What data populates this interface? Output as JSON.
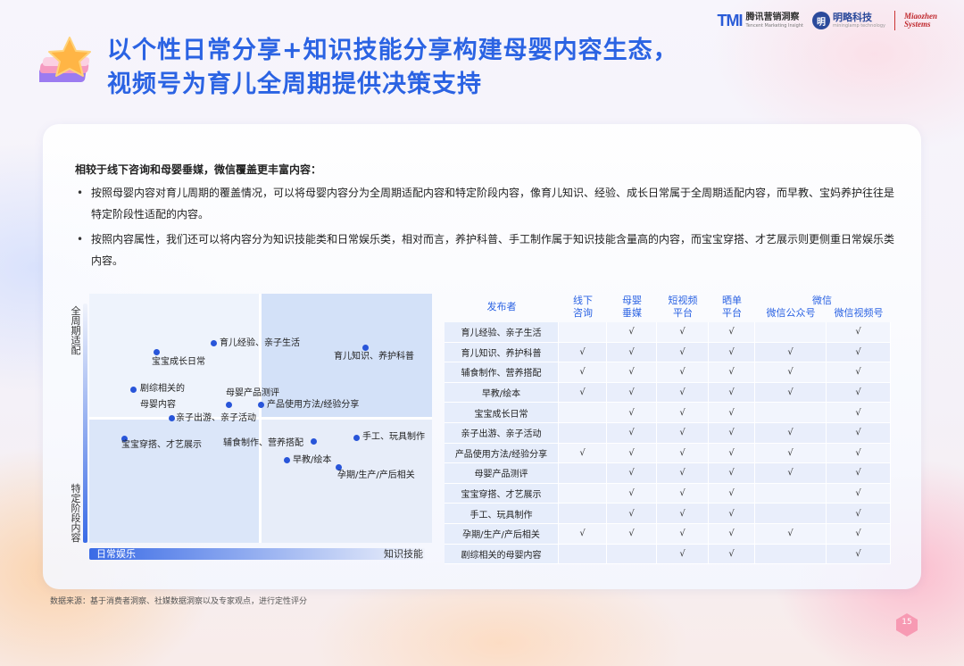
{
  "header": {
    "tmi_mark": "TMI",
    "tmi_cn": "腾讯营销洞察",
    "tmi_en": "Tencent Marketing Insight",
    "mlk_mark": "明",
    "mlk_cn": "明略科技",
    "mlk_en": "mininglamp technology",
    "mz_line1": "Miaozhen",
    "mz_line2": "Systems"
  },
  "title": {
    "line1": "以个性日常分享+知识技能分享构建母婴内容生态，",
    "line2": "视频号为育儿全周期提供决策支持"
  },
  "intro": {
    "heading": "相较于线下咨询和母婴垂媒，微信覆盖更丰富内容：",
    "bullet1": "按照母婴内容对育儿周期的覆盖情况，可以将母婴内容分为全周期适配内容和特定阶段内容，像育儿知识、经验、成长日常属于全周期适配内容，而早教、宝妈养护往往是特定阶段性适配的内容。",
    "bullet2": "按照内容属性，我们还可以将内容分为知识技能类和日常娱乐类，相对而言，养护科普、手工制作属于知识技能含量高的内容，而宝宝穿搭、才艺展示则更侧重日常娱乐类内容。"
  },
  "quadrant": {
    "y_top": "全周期适配",
    "y_bottom": "特定阶段内容",
    "x_left": "日常娱乐",
    "x_right": "知识技能",
    "points": {
      "p1": "育儿经验、亲子生活",
      "p2": "宝宝成长日常",
      "p3": "育儿知识、养护科普",
      "p4a": "剧综相关的",
      "p4b": "母婴内容",
      "p5": "母婴产品测评",
      "p6": "产品使用方法/经验分享",
      "p7": "亲子出游、亲子活动",
      "p8": "宝宝穿搭、才艺展示",
      "p9": "辅食制作、营养搭配",
      "p10": "手工、玩具制作",
      "p11": "早教/绘本",
      "p12": "孕期/生产/产后相关"
    }
  },
  "table": {
    "headers": {
      "publisher": "发布者",
      "offline_1": "线下",
      "offline_2": "咨询",
      "maternal_1": "母婴",
      "maternal_2": "垂媒",
      "short_1": "短视频",
      "short_2": "平台",
      "share_1": "晒单",
      "share_2": "平台",
      "wechat": "微信",
      "wechat_oa": "微信公众号",
      "wechat_ch": "微信视频号"
    },
    "rows": [
      {
        "name": "育儿经验、亲子生活",
        "c": [
          "",
          "√",
          "√",
          "√",
          "",
          "√"
        ]
      },
      {
        "name": "育儿知识、养护科普",
        "c": [
          "√",
          "√",
          "√",
          "√",
          "√",
          "√"
        ]
      },
      {
        "name": "辅食制作、营养搭配",
        "c": [
          "√",
          "√",
          "√",
          "√",
          "√",
          "√"
        ]
      },
      {
        "name": "早教/绘本",
        "c": [
          "√",
          "√",
          "√",
          "√",
          "√",
          "√"
        ]
      },
      {
        "name": "宝宝成长日常",
        "c": [
          "",
          "√",
          "√",
          "√",
          "",
          "√"
        ]
      },
      {
        "name": "亲子出游、亲子活动",
        "c": [
          "",
          "√",
          "√",
          "√",
          "√",
          "√"
        ]
      },
      {
        "name": "产品使用方法/经验分享",
        "c": [
          "√",
          "√",
          "√",
          "√",
          "√",
          "√"
        ]
      },
      {
        "name": "母婴产品测评",
        "c": [
          "",
          "√",
          "√",
          "√",
          "√",
          "√"
        ]
      },
      {
        "name": "宝宝穿搭、才艺展示",
        "c": [
          "",
          "√",
          "√",
          "√",
          "",
          "√"
        ]
      },
      {
        "name": "手工、玩具制作",
        "c": [
          "",
          "√",
          "√",
          "√",
          "",
          "√"
        ]
      },
      {
        "name": "孕期/生产/产后相关",
        "c": [
          "√",
          "√",
          "√",
          "√",
          "√",
          "√"
        ]
      },
      {
        "name": "剧综相关的母婴内容",
        "c": [
          "",
          "",
          "√",
          "√",
          "",
          "√"
        ]
      }
    ]
  },
  "footer": {
    "source": "数据来源：基于消费者洞察、社媒数据洞察以及专家观点，进行定性评分",
    "page": "15"
  },
  "colors": {
    "title_blue": "#2b63e3",
    "dot_blue": "#2855d9",
    "brand_red": "#c0282d"
  }
}
